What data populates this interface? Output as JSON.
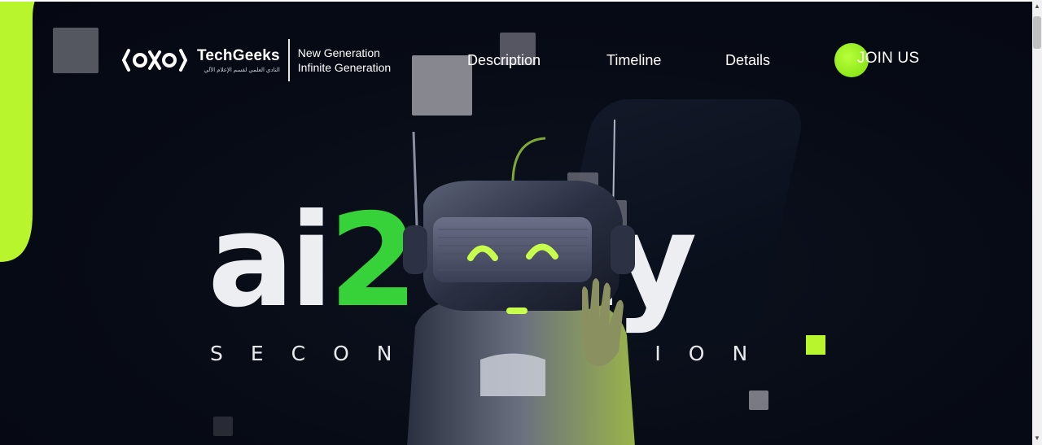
{
  "brand": {
    "name": "TechGeeks",
    "arabic": "النادي العلمي لقسم الإعلام الآلي",
    "tagline_line1": "New Generation",
    "tagline_line2": "Infinite Generation"
  },
  "nav": {
    "description": "Description",
    "timeline": "Timeline",
    "details": "Details",
    "join": "JOIN US"
  },
  "hero": {
    "title_part1": "ai",
    "title_accent": "2",
    "title_part2": "ay",
    "subtitle": "SECOND EDITION"
  },
  "colors": {
    "accent_lime": "#b8f52c",
    "accent_green": "#37d13a",
    "background": "#070b15"
  },
  "icons": {
    "logo": "techgeeks-logo-icon",
    "robot": "robot-illustration"
  }
}
